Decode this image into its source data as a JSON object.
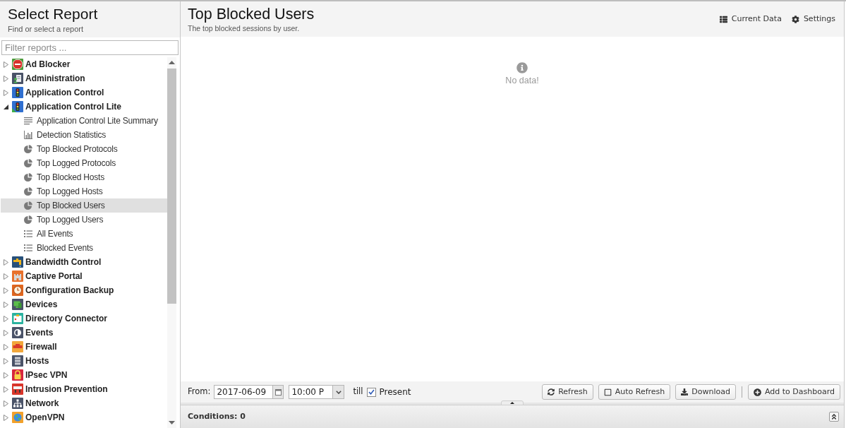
{
  "sidebar": {
    "title": "Select Report",
    "subtitle": "Find or select a report",
    "filter": {
      "placeholder": "Filter reports ..."
    },
    "items": [
      {
        "label": "Ad Blocker",
        "expanded": false,
        "selected": false
      },
      {
        "label": "Administration",
        "expanded": false,
        "selected": false
      },
      {
        "label": "Application Control",
        "expanded": false,
        "selected": false
      },
      {
        "label": "Application Control Lite",
        "expanded": true,
        "selected": false,
        "children": [
          {
            "label": "Application Control Lite Summary",
            "kind": "text",
            "selected": false
          },
          {
            "label": "Detection Statistics",
            "kind": "time_graph",
            "selected": false
          },
          {
            "label": "Top Blocked Protocols",
            "kind": "pie_graph",
            "selected": false
          },
          {
            "label": "Top Logged Protocols",
            "kind": "pie_graph",
            "selected": false
          },
          {
            "label": "Top Blocked Hosts",
            "kind": "pie_graph",
            "selected": false
          },
          {
            "label": "Top Logged Hosts",
            "kind": "pie_graph",
            "selected": false
          },
          {
            "label": "Top Blocked Users",
            "kind": "pie_graph",
            "selected": true
          },
          {
            "label": "Top Logged Users",
            "kind": "pie_graph",
            "selected": false
          },
          {
            "label": "All Events",
            "kind": "event_list",
            "selected": false
          },
          {
            "label": "Blocked Events",
            "kind": "event_list",
            "selected": false
          }
        ]
      },
      {
        "label": "Bandwidth Control",
        "expanded": false,
        "selected": false
      },
      {
        "label": "Captive Portal",
        "expanded": false,
        "selected": false
      },
      {
        "label": "Configuration Backup",
        "expanded": false,
        "selected": false
      },
      {
        "label": "Devices",
        "expanded": false,
        "selected": false
      },
      {
        "label": "Directory Connector",
        "expanded": false,
        "selected": false
      },
      {
        "label": "Events",
        "expanded": false,
        "selected": false
      },
      {
        "label": "Firewall",
        "expanded": false,
        "selected": false
      },
      {
        "label": "Hosts",
        "expanded": false,
        "selected": false
      },
      {
        "label": "IPsec VPN",
        "expanded": false,
        "selected": false
      },
      {
        "label": "Intrusion Prevention",
        "expanded": false,
        "selected": false
      },
      {
        "label": "Network",
        "expanded": false,
        "selected": false
      },
      {
        "label": "OpenVPN",
        "expanded": false,
        "selected": false
      }
    ]
  },
  "report": {
    "title": "Top Blocked Users",
    "subtitle": "The top blocked sessions by user.",
    "actions": [
      {
        "label": "Current Data",
        "kind": "data"
      },
      {
        "label": "Settings",
        "kind": "settings"
      }
    ],
    "empty_message": "No data!"
  },
  "toolbar": {
    "from_label": "From:",
    "date": "2017-06-09",
    "time": "10:00 P",
    "till_label": "till",
    "present": {
      "label": "Present",
      "checked": true
    },
    "buttons": [
      {
        "label": "Refresh",
        "kind": "refresh"
      },
      {
        "label": "Auto Refresh",
        "kind": "toggle",
        "checked": false
      },
      {
        "label": "Download",
        "kind": "download"
      },
      {
        "label": "Add to Dashboard",
        "kind": "add"
      }
    ]
  },
  "conditions": {
    "label": "Conditions: 0"
  }
}
